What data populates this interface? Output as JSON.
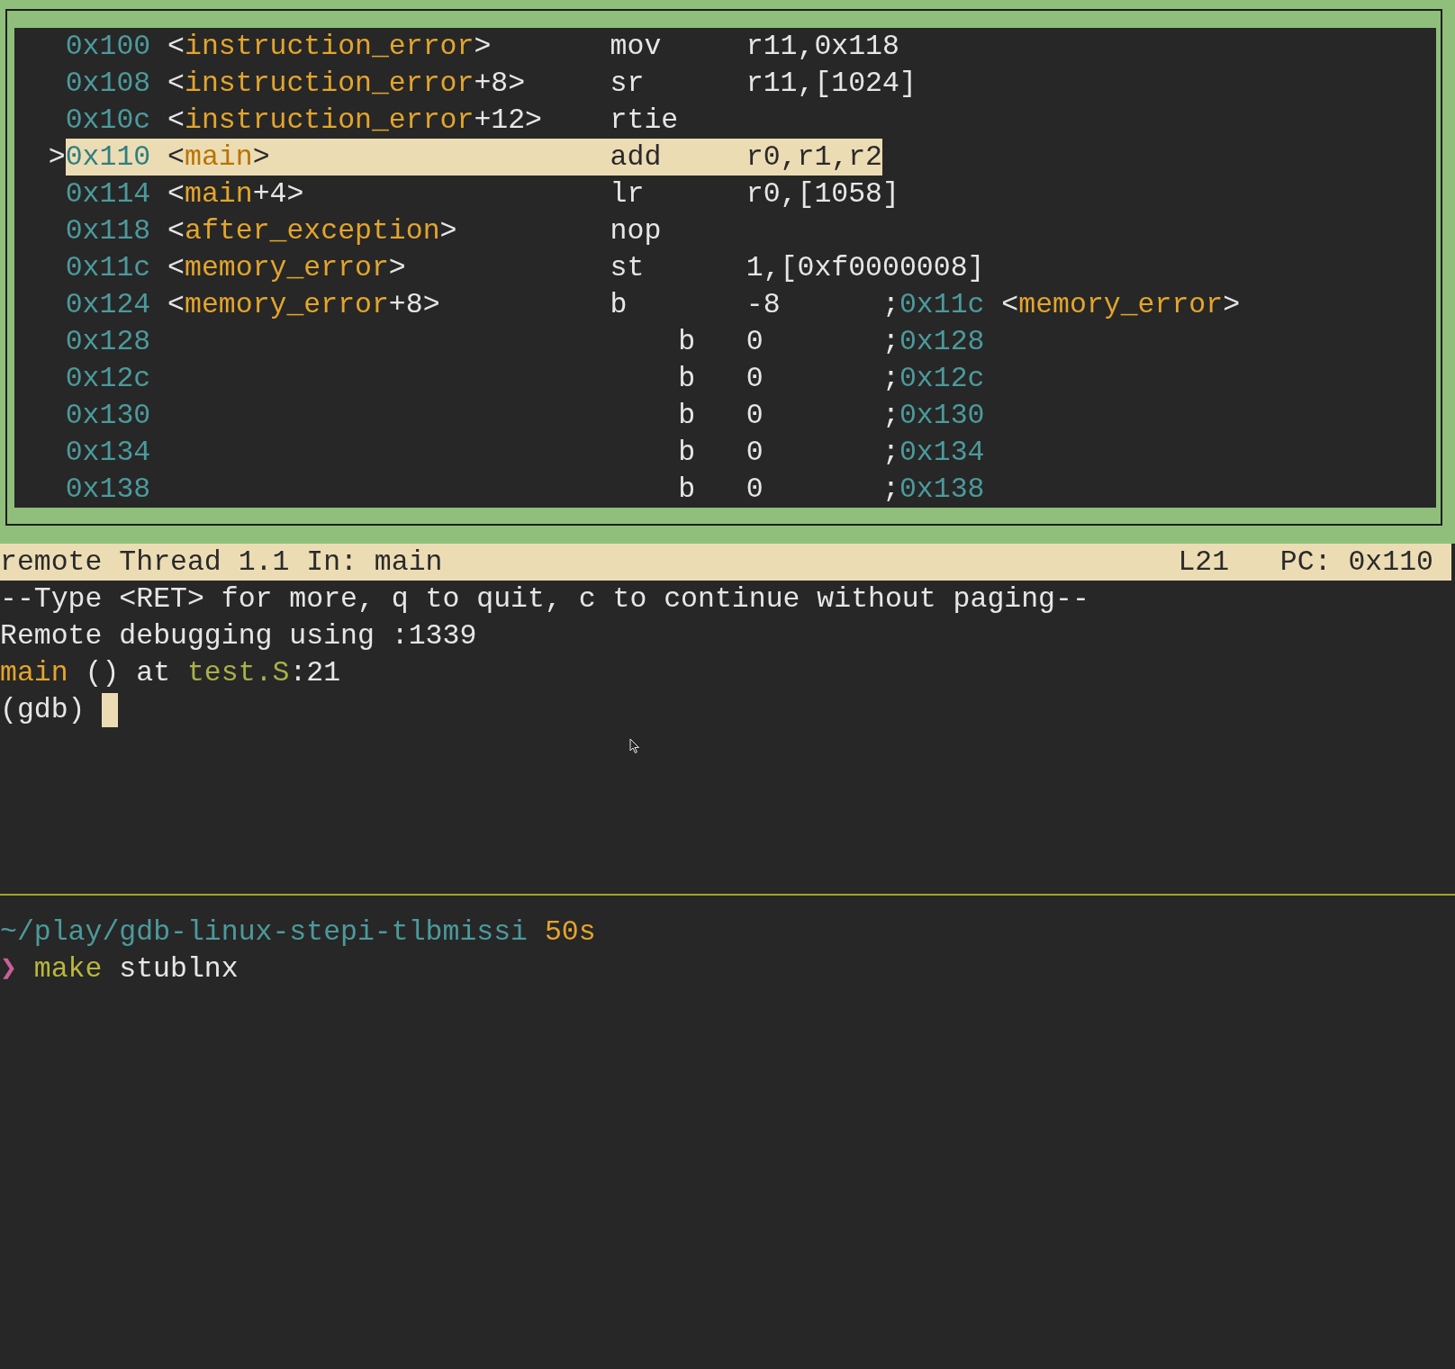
{
  "disassembly": {
    "rows": [
      {
        "kind": "symbol",
        "address": "0x100",
        "symbol": [
          {
            "text": "<",
            "kind": "plain"
          },
          {
            "text": "instruction_error",
            "kind": "symbol"
          },
          {
            "text": ">",
            "kind": "plain"
          }
        ],
        "mnemonic": "mov",
        "operands": "r11,0x118",
        "current": false
      },
      {
        "kind": "symbol",
        "address": "0x108",
        "symbol": [
          {
            "text": "<",
            "kind": "plain"
          },
          {
            "text": "instruction_error",
            "kind": "symbol"
          },
          {
            "text": "+8>",
            "kind": "plain"
          }
        ],
        "mnemonic": "sr",
        "operands": "r11,[1024]",
        "current": false
      },
      {
        "kind": "symbol",
        "address": "0x10c",
        "symbol": [
          {
            "text": "<",
            "kind": "plain"
          },
          {
            "text": "instruction_error",
            "kind": "symbol"
          },
          {
            "text": "+12>",
            "kind": "plain"
          }
        ],
        "mnemonic": "rtie",
        "current": false
      },
      {
        "kind": "symbol",
        "marker": ">",
        "address": "0x110",
        "symbol": [
          {
            "text": "<",
            "kind": "plain"
          },
          {
            "text": "main",
            "kind": "symbol"
          },
          {
            "text": ">",
            "kind": "plain"
          }
        ],
        "mnemonic": "add",
        "operands": "r0,r1,r2",
        "current": true
      },
      {
        "kind": "symbol",
        "address": "0x114",
        "symbol": [
          {
            "text": "<",
            "kind": "plain"
          },
          {
            "text": "main",
            "kind": "symbol"
          },
          {
            "text": "+4>",
            "kind": "plain"
          }
        ],
        "mnemonic": "lr",
        "operands": "r0,[1058]",
        "current": false
      },
      {
        "kind": "symbol",
        "address": "0x118",
        "symbol": [
          {
            "text": "<",
            "kind": "plain"
          },
          {
            "text": "after_exception",
            "kind": "symbol"
          },
          {
            "text": ">",
            "kind": "plain"
          }
        ],
        "mnemonic": "nop",
        "current": false
      },
      {
        "kind": "symbol",
        "address": "0x11c",
        "symbol": [
          {
            "text": "<",
            "kind": "plain"
          },
          {
            "text": "memory_error",
            "kind": "symbol"
          },
          {
            "text": ">",
            "kind": "plain"
          }
        ],
        "mnemonic": "st",
        "operands": "1,[0xf0000008]",
        "current": false
      },
      {
        "kind": "symbol",
        "address": "0x124",
        "symbol": [
          {
            "text": "<",
            "kind": "plain"
          },
          {
            "text": "memory_error",
            "kind": "symbol"
          },
          {
            "text": "+8>",
            "kind": "plain"
          }
        ],
        "mnemonic": "b",
        "operands": "-8",
        "comment": [
          {
            "text": ";",
            "kind": "plain"
          },
          {
            "text": "0x11c",
            "kind": "address"
          },
          {
            "text": " <",
            "kind": "plain"
          },
          {
            "text": "memory_error",
            "kind": "symbol"
          },
          {
            "text": ">",
            "kind": "plain"
          }
        ],
        "current": false
      },
      {
        "kind": "raw",
        "address": "0x128",
        "mnemonic": "b",
        "operands": "0",
        "comment": [
          {
            "text": ";",
            "kind": "plain"
          },
          {
            "text": "0x128",
            "kind": "address"
          }
        ],
        "current": false
      },
      {
        "kind": "raw",
        "address": "0x12c",
        "mnemonic": "b",
        "operands": "0",
        "comment": [
          {
            "text": ";",
            "kind": "plain"
          },
          {
            "text": "0x12c",
            "kind": "address"
          }
        ],
        "current": false
      },
      {
        "kind": "raw",
        "address": "0x130",
        "mnemonic": "b",
        "operands": "0",
        "comment": [
          {
            "text": ";",
            "kind": "plain"
          },
          {
            "text": "0x130",
            "kind": "address"
          }
        ],
        "current": false
      },
      {
        "kind": "raw",
        "address": "0x134",
        "mnemonic": "b",
        "operands": "0",
        "comment": [
          {
            "text": ";",
            "kind": "plain"
          },
          {
            "text": "0x134",
            "kind": "address"
          }
        ],
        "current": false
      },
      {
        "kind": "raw",
        "address": "0x138",
        "mnemonic": "b",
        "operands": "0",
        "comment": [
          {
            "text": ";",
            "kind": "plain"
          },
          {
            "text": "0x138",
            "kind": "address"
          }
        ],
        "current": false
      }
    ]
  },
  "status_bar": {
    "target": "remote Thread 1.1 In: main",
    "line": "L21",
    "pc": "PC: 0x110"
  },
  "console": {
    "lines": [
      [
        {
          "text": "--Type <RET> for more, q to quit, c to continue without paging--",
          "kind": "plain"
        }
      ],
      [
        {
          "text": "Remote debugging using :1339",
          "kind": "plain"
        }
      ],
      [
        {
          "text": "main",
          "kind": "symbol"
        },
        {
          "text": " () at ",
          "kind": "plain"
        },
        {
          "text": "test.S",
          "kind": "file"
        },
        {
          "text": ":21",
          "kind": "plain"
        }
      ]
    ],
    "prompt": "(gdb) "
  },
  "shell": {
    "path": "~/play/gdb-linux-stepi-tlbmissi",
    "duration": "50s",
    "prompt_symbol": "❯",
    "command": "make",
    "argument": "stublnx"
  }
}
